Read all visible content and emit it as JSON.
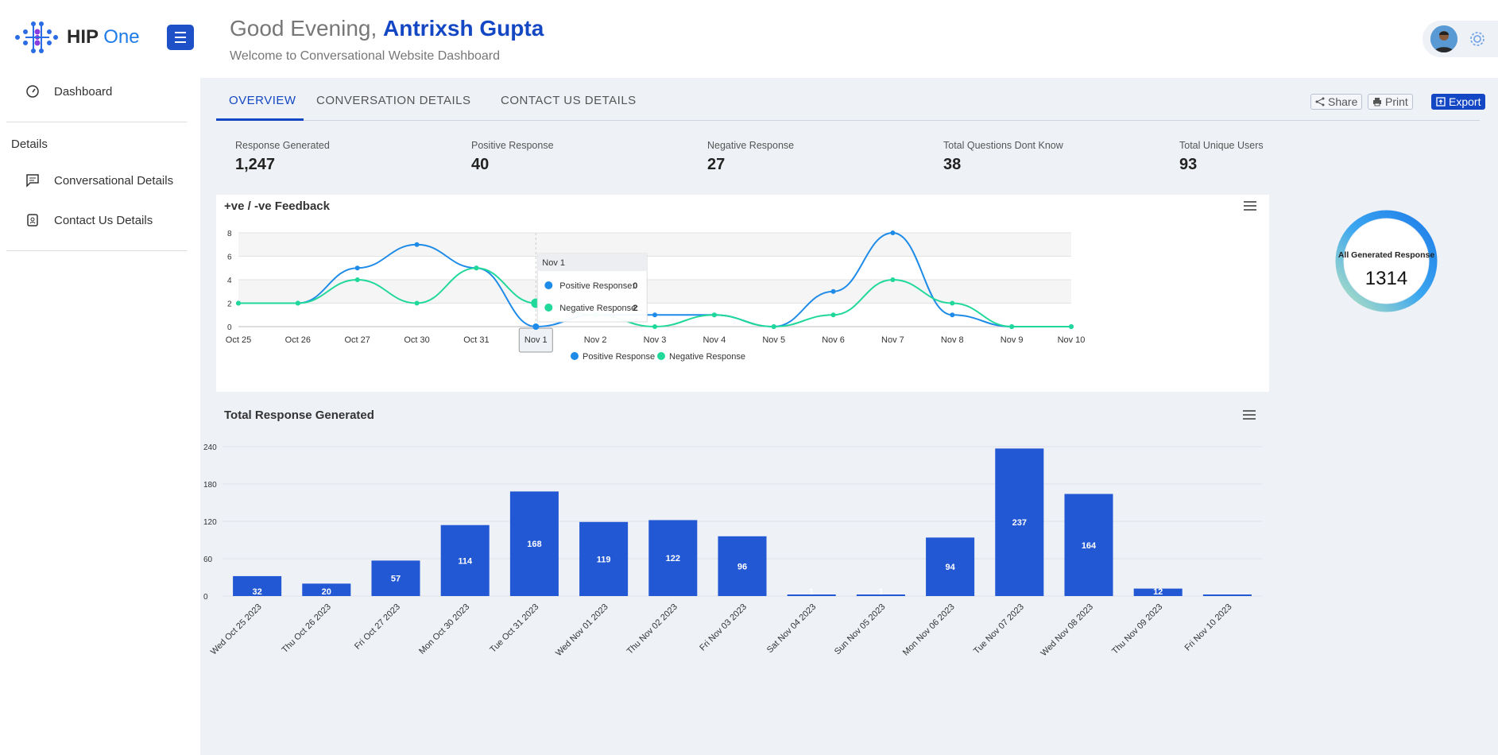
{
  "brand": {
    "name_bold": "HIP",
    "name_light": "One"
  },
  "sidebar": {
    "items": [
      {
        "label": "Dashboard"
      },
      {
        "label": "Conversational Details"
      },
      {
        "label": "Contact Us Details"
      }
    ],
    "section_label": "Details"
  },
  "header": {
    "greeting": "Good Evening,",
    "user_name": "Antrixsh Gupta",
    "subtitle": "Welcome to Conversational Website Dashboard"
  },
  "tabs": [
    {
      "label": "OVERVIEW"
    },
    {
      "label": "CONVERSATION DETAILS"
    },
    {
      "label": "CONTACT US DETAILS"
    }
  ],
  "toolbar": {
    "share": "Share",
    "print": "Print",
    "export": "Export"
  },
  "kpis": [
    {
      "label": "Response Generated",
      "value": "1,247"
    },
    {
      "label": "Positive Response",
      "value": "40"
    },
    {
      "label": "Negative Response",
      "value": "27"
    },
    {
      "label": "Total Questions Dont Know",
      "value": "38"
    },
    {
      "label": "Total Unique Users",
      "value": "93"
    }
  ],
  "gauge": {
    "label": "All Generated Response",
    "value": "1314"
  },
  "colors": {
    "accent": "#1447c4",
    "positive": "#1e8be8",
    "negative": "#1fd89a",
    "bar": "#2358d4"
  },
  "chart_data": [
    {
      "type": "line",
      "title": "+ve / -ve Feedback",
      "categories": [
        "Oct 25",
        "Oct 26",
        "Oct 27",
        "Oct 30",
        "Oct 31",
        "Nov 1",
        "Nov 2",
        "Nov 3",
        "Nov 4",
        "Nov 5",
        "Nov 6",
        "Nov 7",
        "Nov 8",
        "Nov 9",
        "Nov 10"
      ],
      "series": [
        {
          "name": "Positive Response",
          "values": [
            2,
            2,
            5,
            7,
            5,
            0,
            1,
            1,
            1,
            0,
            3,
            8,
            1,
            0,
            0
          ]
        },
        {
          "name": "Negative Response",
          "values": [
            2,
            2,
            4,
            2,
            5,
            2,
            1,
            0,
            1,
            0,
            1,
            4,
            2,
            0,
            0
          ]
        }
      ],
      "ylim": [
        0,
        8
      ],
      "yticks": [
        0,
        2,
        4,
        6,
        8
      ],
      "legend": "bottom",
      "tooltip": {
        "title": "Nov 1",
        "rows": [
          {
            "label": "Positive Response:",
            "value": "0"
          },
          {
            "label": "Negative Response:",
            "value": "2"
          }
        ]
      }
    },
    {
      "type": "bar",
      "title": "Total Response Generated",
      "categories": [
        "Wed Oct 25 2023",
        "Thu Oct 26 2023",
        "Fri Oct 27 2023",
        "Mon Oct 30 2023",
        "Tue Oct 31 2023",
        "Wed Nov 01 2023",
        "Thu Nov 02 2023",
        "Fri Nov 03 2023",
        "Sat Nov 04 2023",
        "Sun Nov 05 2023",
        "Mon Nov 06 2023",
        "Tue Nov 07 2023",
        "Wed Nov 08 2023",
        "Thu Nov 09 2023",
        "Fri Nov 10 2023"
      ],
      "values": [
        32,
        20,
        57,
        114,
        168,
        119,
        122,
        96,
        1,
        1,
        94,
        237,
        164,
        12,
        0
      ],
      "ylim": [
        0,
        240
      ],
      "yticks": [
        0,
        60,
        120,
        180,
        240
      ]
    }
  ]
}
